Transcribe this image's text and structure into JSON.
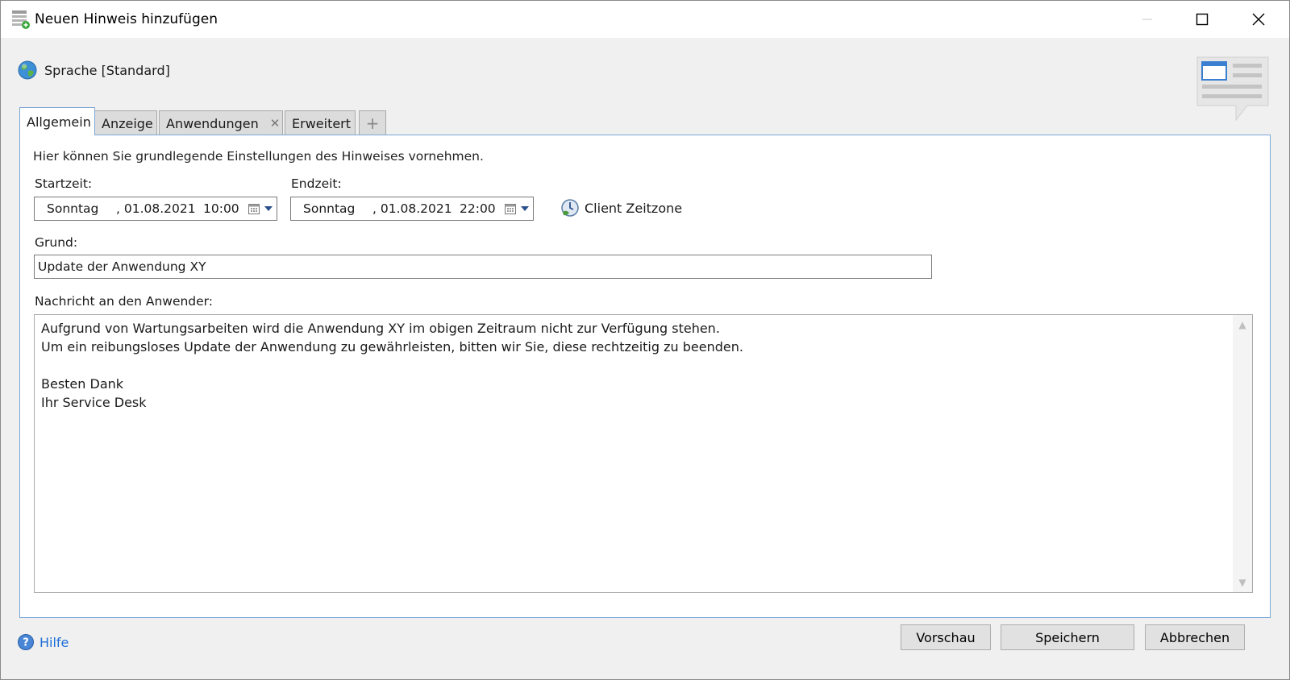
{
  "window": {
    "title": "Neuen Hinweis hinzufügen",
    "controls": {
      "minimize": "—",
      "maximize": "☐",
      "close": "✕"
    }
  },
  "language": {
    "label": "Sprache [Standard]",
    "icon": "globe-icon"
  },
  "tabs": [
    {
      "label": "Allgemein",
      "active": true
    },
    {
      "label": "Anzeige",
      "active": false
    },
    {
      "label": "Anwendungen",
      "active": false,
      "closable": true
    },
    {
      "label": "Erweitert",
      "active": false
    },
    {
      "label": "+",
      "active": false
    }
  ],
  "general": {
    "hint": "Hier können Sie grundlegende Einstellungen des Hinweises vornehmen.",
    "start": {
      "label": "Startzeit:",
      "day": "Sonntag",
      "date": ", 01.08.2021",
      "time": "10:00"
    },
    "end": {
      "label": "Endzeit:",
      "day": "Sonntag",
      "date": ", 01.08.2021",
      "time": "22:00"
    },
    "timezone": {
      "label": "Client Zeitzone",
      "icon": "clock-globe-icon"
    },
    "reason": {
      "label": "Grund:",
      "value": "Update der Anwendung XY"
    },
    "message": {
      "label": "Nachricht an den Anwender:",
      "value": "Aufgrund von Wartungsarbeiten wird die Anwendung XY im obigen Zeitraum nicht zur Verfügung stehen.\nUm ein reibungsloses Update der Anwendung zu gewährleisten, bitten wir Sie, diese rechtzeitig zu beenden.\n\nBesten Dank\nIhr Service Desk"
    }
  },
  "footer": {
    "help": "Hilfe",
    "preview": "Vorschau",
    "save": "Speichern",
    "cancel": "Abbrechen"
  },
  "colors": {
    "accent": "#7aa7d6",
    "link": "#1e6fd9",
    "button": "#e1e1e1"
  }
}
